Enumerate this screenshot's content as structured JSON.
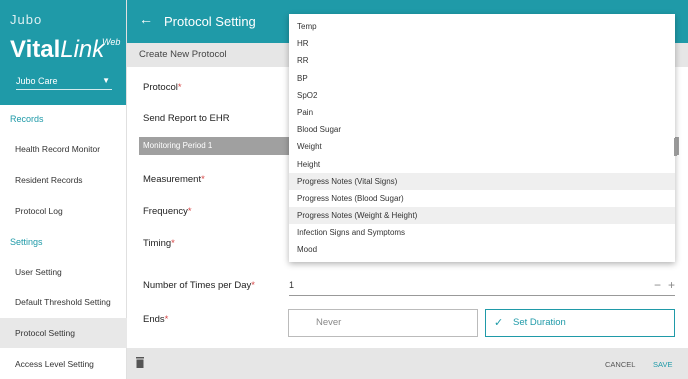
{
  "brand": {
    "top": "Jubo",
    "vital": "Vital",
    "link": "Link",
    "web": "Web",
    "org": "Jubo Care"
  },
  "sidebar": {
    "records_label": "Records",
    "records": [
      "Health Record Monitor",
      "Resident Records",
      "Protocol Log"
    ],
    "settings_label": "Settings",
    "settings": [
      "User Setting",
      "Default Threshold Setting",
      "Protocol Setting",
      "Access Level Setting"
    ],
    "active": "Protocol Setting"
  },
  "header": {
    "title": "Protocol Setting",
    "back_icon": "arrow-left-icon"
  },
  "subheader": {
    "title": "Create New Protocol"
  },
  "form": {
    "protocol": "Protocol",
    "send_report": "Send Report to EHR",
    "period": "Monitoring Period 1",
    "measurement": "Measurement",
    "frequency": "Frequency",
    "timing": "Timing",
    "times_per_day": "Number of Times per Day",
    "times_value": "1",
    "ends": "Ends",
    "never": "Never",
    "set_duration": "Set Duration",
    "req": "*"
  },
  "footer": {
    "cancel": "CANCEL",
    "save": "SAVE"
  },
  "dropdown": {
    "options": [
      "Temp",
      "HR",
      "RR",
      "BP",
      "SpO2",
      "Pain",
      "Blood Sugar",
      "Weight",
      "Height",
      "Progress Notes (Vital Signs)",
      "Progress Notes (Blood Sugar)",
      "Progress Notes (Weight & Height)",
      "Infection Signs and Symptoms",
      "Mood"
    ],
    "highlighted": "Progress Notes (Vital Signs)"
  },
  "colors": {
    "accent": "#1f9aa8",
    "required": "#d64545"
  }
}
